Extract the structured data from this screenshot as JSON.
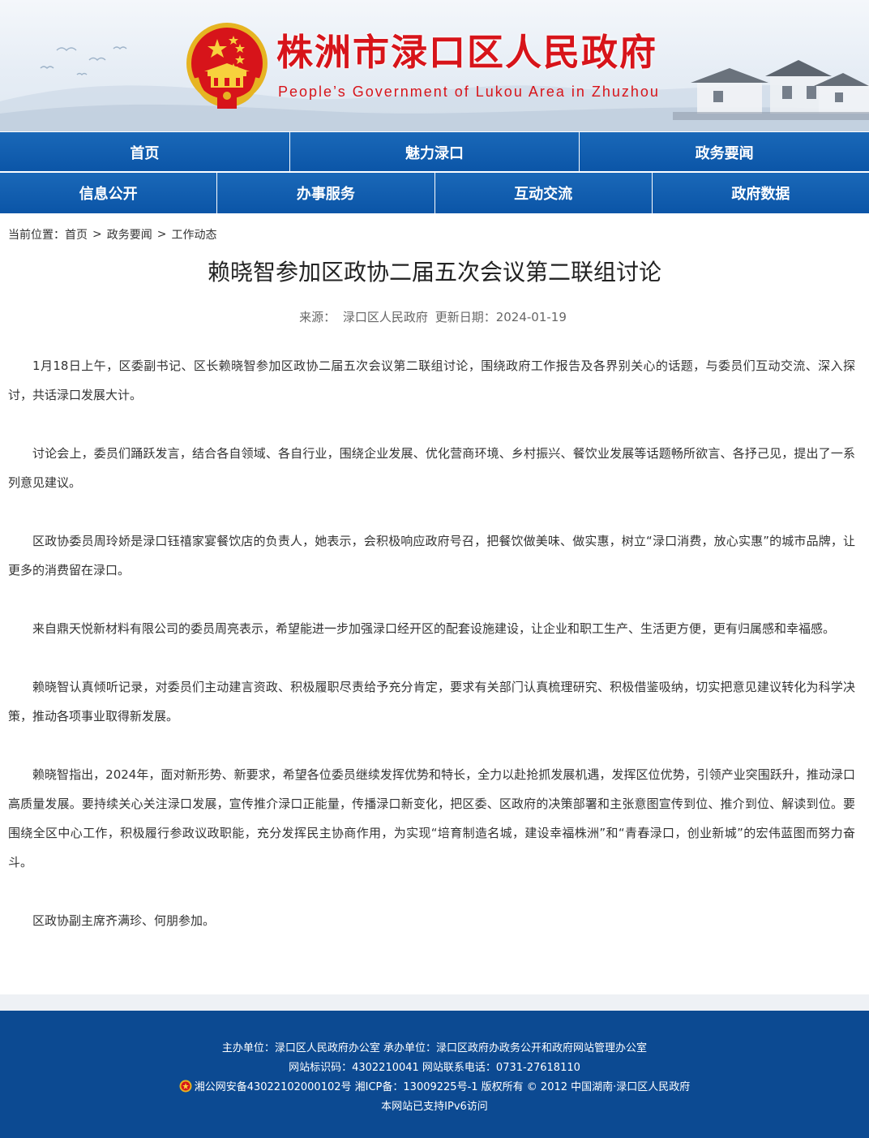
{
  "header": {
    "title": "株洲市渌口区人民政府",
    "subtitle": "People’s Government of Lukou Area in Zhuzhou",
    "emblem_icon": "national-emblem-icon",
    "brand_red": "#d7141a"
  },
  "nav": {
    "row1": [
      "首页",
      "魅力渌口",
      "政务要闻"
    ],
    "row2": [
      "信息公开",
      "办事服务",
      "互动交流",
      "政府数据"
    ],
    "color": "#0b55a7"
  },
  "breadcrumb": {
    "prefix": "当前位置：",
    "items": [
      "首页",
      "政务要闻",
      "工作动态"
    ],
    "separator": ">"
  },
  "article": {
    "title": "赖晓智参加区政协二届五次会议第二联组讨论",
    "source_label": "来源：",
    "source": "渌口区人民政府",
    "date_label": "更新日期：",
    "date": "2024-01-19",
    "paragraphs": [
      "1月18日上午，区委副书记、区长赖晓智参加区政协二届五次会议第二联组讨论，围绕政府工作报告及各界别关心的话题，与委员们互动交流、深入探讨，共话渌口发展大计。",
      "讨论会上，委员们踊跃发言，结合各自领域、各自行业，围绕企业发展、优化营商环境、乡村振兴、餐饮业发展等话题畅所欲言、各抒己见，提出了一系列意见建议。",
      "区政协委员周玲娇是渌口钰禧家宴餐饮店的负责人，她表示，会积极响应政府号召，把餐饮做美味、做实惠，树立“渌口消费，放心实惠”的城市品牌，让更多的消费留在渌口。",
      "来自鼎天悦新材料有限公司的委员周亮表示，希望能进一步加强渌口经开区的配套设施建设，让企业和职工生产、生活更方便，更有归属感和幸福感。",
      "赖晓智认真倾听记录，对委员们主动建言资政、积极履职尽责给予充分肯定，要求有关部门认真梳理研究、积极借鉴吸纳，切实把意见建议转化为科学决策，推动各项事业取得新发展。",
      "赖晓智指出，2024年，面对新形势、新要求，希望各位委员继续发挥优势和特长，全力以赴抢抓发展机遇，发挥区位优势，引领产业突围跃升，推动渌口高质量发展。要持续关心关注渌口发展，宣传推介渌口正能量，传播渌口新变化，把区委、区政府的决策部署和主张意图宣传到位、推介到位、解读到位。要围绕全区中心工作，积极履行参政议政职能，充分发挥民主协商作用，为实现“培育制造名城，建设幸福株洲”和“青春渌口，创业新城”的宏伟蓝图而努力奋斗。",
      "区政协副主席齐满珍、何朋参加。"
    ]
  },
  "footer": {
    "line1": "主办单位：渌口区人民政府办公室 承办单位：渌口区政府办政务公开和政府网站管理办公室",
    "line2": "网站标识码：4302210041 网站联系电话：0731-27618110",
    "line3": "湘公网安备43022102000102号 湘ICP备：13009225号-1 版权所有 © 2012 中国湖南·渌口区人民政府",
    "line4": "本网站已支持IPv6访问",
    "police_icon": "police-badge-icon",
    "color": "#0c4a92"
  }
}
